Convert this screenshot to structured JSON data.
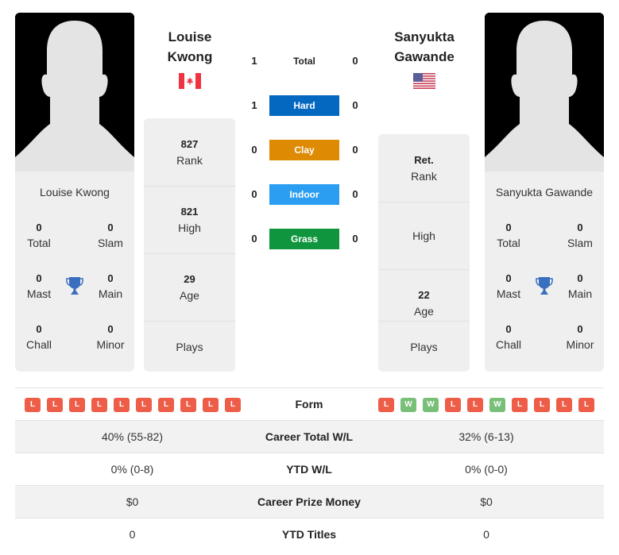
{
  "colors": {
    "hard": "#0468c0",
    "clay": "#de8a03",
    "indoor": "#2b9ef2",
    "grass": "#0f953d",
    "loss": "#ee5d48",
    "win": "#78bf78",
    "trophy": "#3a6fbf"
  },
  "player1": {
    "name": "Louise Kwong",
    "name_line1": "Louise",
    "name_line2": "Kwong",
    "flag": "canada-flag",
    "titles": {
      "total": "0",
      "total_label": "Total",
      "slam": "0",
      "slam_label": "Slam",
      "mast": "0",
      "mast_label": "Mast",
      "main": "0",
      "main_label": "Main",
      "chall": "0",
      "chall_label": "Chall",
      "minor": "0",
      "minor_label": "Minor"
    },
    "stats": [
      {
        "value": "827",
        "label": "Rank"
      },
      {
        "value": "821",
        "label": "High"
      },
      {
        "value": "29",
        "label": "Age"
      },
      {
        "value": "",
        "label": "Plays"
      }
    ],
    "form": [
      "L",
      "L",
      "L",
      "L",
      "L",
      "L",
      "L",
      "L",
      "L",
      "L"
    ]
  },
  "player2": {
    "name": "Sanyukta Gawande",
    "name_line1": "Sanyukta",
    "name_line2": "Gawande",
    "flag": "usa-flag",
    "titles": {
      "total": "0",
      "total_label": "Total",
      "slam": "0",
      "slam_label": "Slam",
      "mast": "0",
      "mast_label": "Mast",
      "main": "0",
      "main_label": "Main",
      "chall": "0",
      "chall_label": "Chall",
      "minor": "0",
      "minor_label": "Minor"
    },
    "stats": [
      {
        "value": "Ret.",
        "label": "Rank"
      },
      {
        "value": "",
        "label": "High"
      },
      {
        "value": "22",
        "label": "Age"
      },
      {
        "value": "",
        "label": "Plays"
      }
    ],
    "form": [
      "L",
      "W",
      "W",
      "L",
      "L",
      "W",
      "L",
      "L",
      "L",
      "L"
    ]
  },
  "h2h": [
    {
      "label": "Total",
      "p1": "1",
      "p2": "0"
    },
    {
      "label": "Hard",
      "p1": "1",
      "p2": "0"
    },
    {
      "label": "Clay",
      "p1": "0",
      "p2": "0"
    },
    {
      "label": "Indoor",
      "p1": "0",
      "p2": "0"
    },
    {
      "label": "Grass",
      "p1": "0",
      "p2": "0"
    }
  ],
  "comparison": [
    {
      "label": "Form"
    },
    {
      "label": "Career Total W/L",
      "p1": "40% (55-82)",
      "p2": "32% (6-13)"
    },
    {
      "label": "YTD W/L",
      "p1": "0% (0-8)",
      "p2": "0% (0-0)"
    },
    {
      "label": "Career Prize Money",
      "p1": "$0",
      "p2": "$0"
    },
    {
      "label": "YTD Titles",
      "p1": "0",
      "p2": "0"
    }
  ]
}
